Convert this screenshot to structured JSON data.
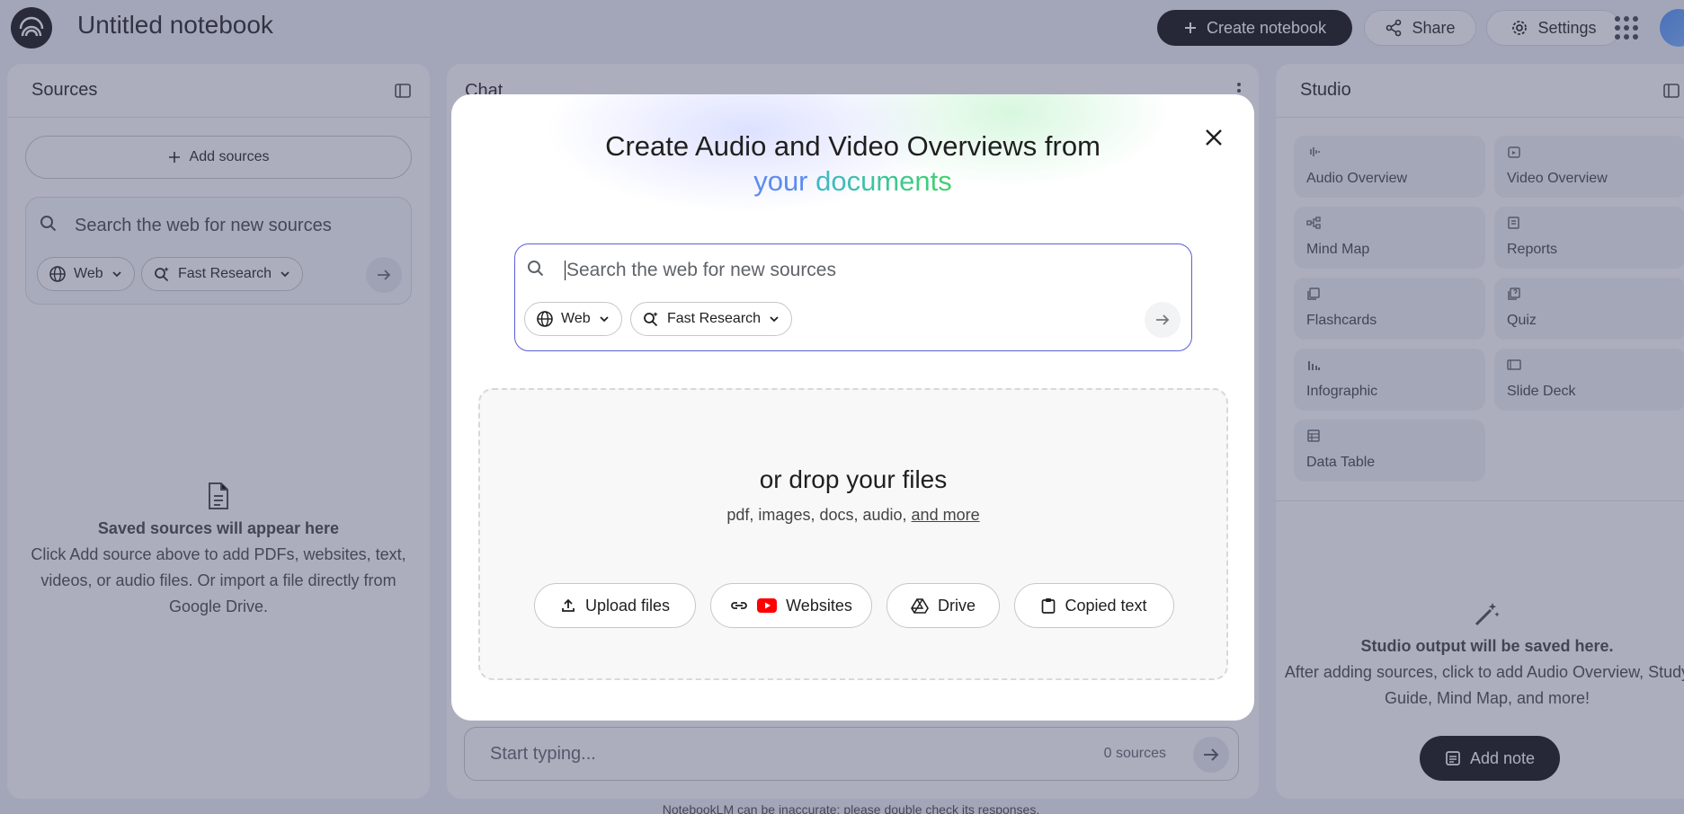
{
  "header": {
    "notebook_title": "Untitled notebook",
    "create_label": "Create notebook",
    "share_label": "Share",
    "settings_label": "Settings"
  },
  "sources": {
    "title": "Sources",
    "add_label": "Add sources",
    "search_placeholder": "Search the web for new sources",
    "chip_web": "Web",
    "chip_research": "Fast Research",
    "empty_heading": "Saved sources will appear here",
    "empty_text": "Click Add source above to add PDFs, websites, text, videos, or audio files. Or import a file directly from Google Drive."
  },
  "chat": {
    "title": "Chat",
    "input_placeholder": "Start typing...",
    "source_count": "0 sources"
  },
  "studio": {
    "title": "Studio",
    "tiles": [
      {
        "label": "Audio Overview",
        "icon": "waveform-icon"
      },
      {
        "label": "Video Overview",
        "icon": "video-icon"
      },
      {
        "label": "Mind Map",
        "icon": "mind-map-icon"
      },
      {
        "label": "Reports",
        "icon": "reports-icon"
      },
      {
        "label": "Flashcards",
        "icon": "flashcards-icon"
      },
      {
        "label": "Quiz",
        "icon": "quiz-icon"
      },
      {
        "label": "Infographic",
        "icon": "bar-chart-icon"
      },
      {
        "label": "Slide Deck",
        "icon": "slides-icon"
      },
      {
        "label": "Data Table",
        "icon": "table-icon"
      }
    ],
    "empty_heading": "Studio output will be saved here.",
    "empty_text": "After adding sources, click to add Audio Overview, Study Guide, Mind Map, and more!",
    "add_note_label": "Add note"
  },
  "footer_note": "NotebookLM can be inaccurate; please double check its responses.",
  "modal": {
    "title_line1": "Create Audio and Video Overviews from",
    "title_line2_a": "your",
    "title_line2_b": "documents",
    "search_placeholder": "Search the web for new sources",
    "chip_web": "Web",
    "chip_research": "Fast Research",
    "drop_title": "or drop your files",
    "drop_sub": "pdf, images, docs, audio,",
    "drop_more": "and more",
    "buttons": {
      "upload": "Upload files",
      "websites": "Websites",
      "drive": "Drive",
      "copied": "Copied text"
    }
  },
  "colors": {
    "accent_blue": "#5b8bf0",
    "accent_green": "#3fd36a",
    "search_border": "#5b5fd6",
    "youtube_red": "#ff0000"
  }
}
